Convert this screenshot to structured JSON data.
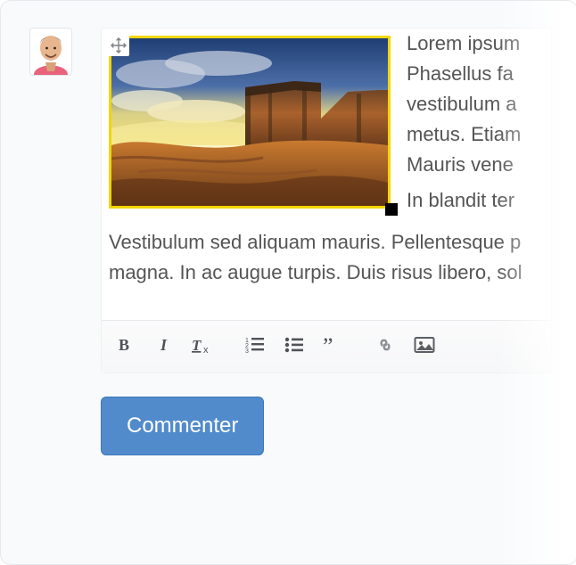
{
  "editor": {
    "text_top": "Lorem ipsum Phasellus fa vestibulum a metus. Etiam Mauris vene",
    "text_after_image": "In blandit ter",
    "text_block": "Vestibulum sed aliquam mauris. Pellentesque p magna. In ac augue turpis. Duis risus libero, sol",
    "image": {
      "alt": "desert-landscape",
      "selected": true
    }
  },
  "toolbar": {
    "bold": "B",
    "italic": "I",
    "clear_format": "Tx",
    "ordered_list": "ordered-list",
    "unordered_list": "unordered-list",
    "blockquote": "blockquote",
    "link": "link",
    "image_btn": "image"
  },
  "submit": {
    "label": "Commenter"
  }
}
